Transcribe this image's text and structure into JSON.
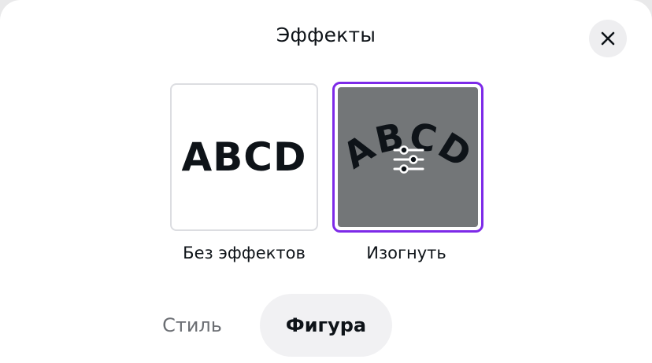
{
  "dialog": {
    "title": "Эффекты",
    "close_icon": "close-icon"
  },
  "effects": [
    {
      "label": "Без эффектов",
      "preview_text": "ABCD",
      "selected": false
    },
    {
      "label": "Изогнуть",
      "preview_text": "ABCD",
      "selected": true,
      "overlay_icon": "sliders-icon"
    }
  ],
  "tabs": [
    {
      "label": "Стиль",
      "active": false
    },
    {
      "label": "Фигура",
      "active": true
    }
  ],
  "colors": {
    "accent": "#7d2ae8",
    "selected_preview_bg": "#737678",
    "active_tab_bg": "#f1f1f3"
  }
}
